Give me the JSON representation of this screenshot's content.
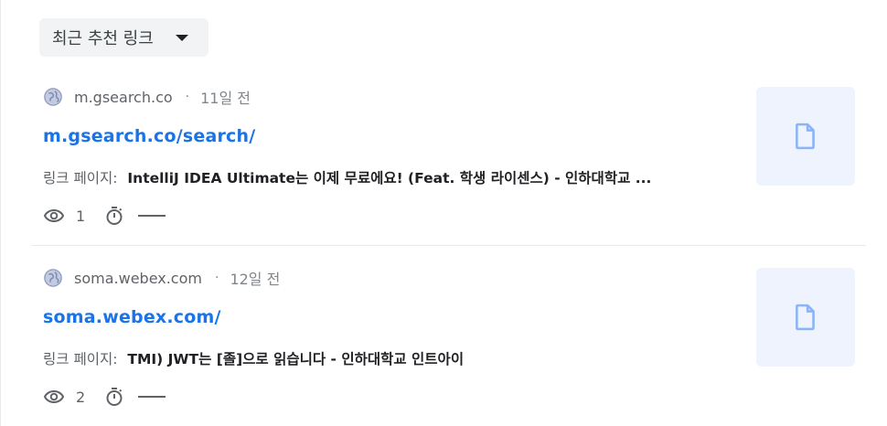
{
  "header": {
    "dropdown_label": "최근 추천 링크"
  },
  "items": [
    {
      "domain": "m.gsearch.co",
      "separator": "·",
      "time_ago": "11일 전",
      "link": "m.gsearch.co/search/",
      "desc_label": "링크 페이지:",
      "desc_text": "IntelliJ IDEA Ultimate는 이제 무료에요! (Feat. 학생 라이센스) - 인하대학교 ...",
      "views": "1"
    },
    {
      "domain": "soma.webex.com",
      "separator": "·",
      "time_ago": "12일 전",
      "link": "soma.webex.com/",
      "desc_label": "링크 페이지:",
      "desc_text": "TMI) JWT는 [졸]으로 읽습니다 - 인하대학교 인트아이",
      "views": "2"
    }
  ],
  "colors": {
    "link": "#1a73e8",
    "thumb_bg": "#eef3fd",
    "icon": "#8ab4f8"
  },
  "icons": [
    "globe-icon",
    "eye-icon",
    "timer-icon",
    "document-icon",
    "caret-down-icon"
  ]
}
